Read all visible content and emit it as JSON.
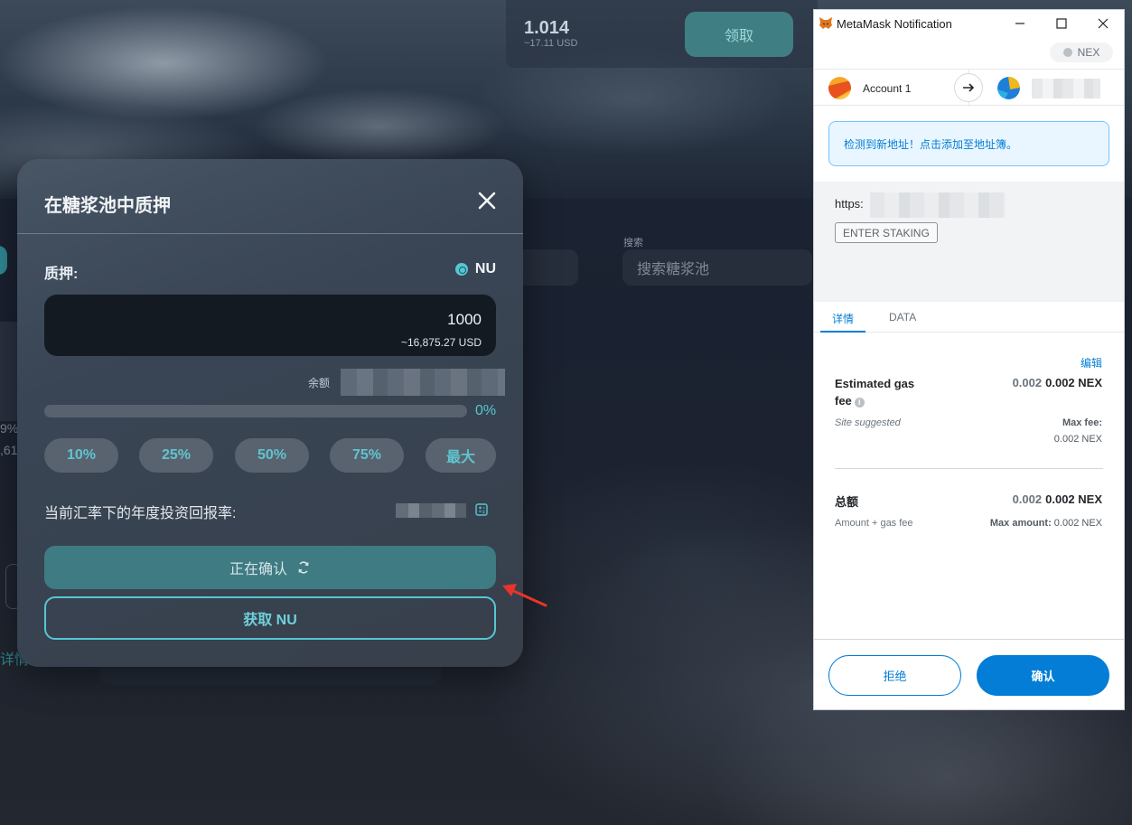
{
  "background": {
    "stat_value": "1.014",
    "stat_usd": "~17.11 USD",
    "claim_label": "领取",
    "search_label": "搜索",
    "search_placeholder": "搜索糖浆池",
    "left_text_1": "9%",
    "left_text_2": ",61",
    "left_text_3": "详情"
  },
  "stake_modal": {
    "title": "在糖浆池中质押",
    "stake_label": "质押:",
    "token": "NU",
    "amount": "1000",
    "amount_usd": "~16,875.27 USD",
    "balance_label": "余额",
    "progress_fraction": 0,
    "progress_pct_label": "0%",
    "percent_buttons": [
      "10%",
      "25%",
      "50%",
      "75%",
      "最大"
    ],
    "apr_label": "当前汇率下的年度投资回报率:",
    "confirming_label": "正在确认",
    "get_token_label": "获取 NU"
  },
  "metamask": {
    "window_title": "MetaMask Notification",
    "network": "NEX",
    "account_name": "Account 1",
    "new_address_notice": "检测到新地址！点击添加至地址簿。",
    "origin": "https:",
    "method": "ENTER STAKING",
    "tabs": [
      "详情",
      "DATA"
    ],
    "edit_label": "编辑",
    "gas_label": "Estimated gas fee",
    "gas_value_secondary": "0.002",
    "gas_value_primary": "0.002 NEX",
    "site_suggested": "Site suggested",
    "max_fee_label": "Max fee:",
    "max_fee_value": "0.002 NEX",
    "total_label": "总额",
    "total_value_secondary": "0.002",
    "total_value_primary": "0.002 NEX",
    "total_sub": "Amount + gas fee",
    "max_amount_label": "Max amount:",
    "max_amount_value": "0.002 NEX",
    "reject_label": "拒绝",
    "confirm_label": "确认"
  },
  "colors": {
    "accent_teal": "#56c6d2",
    "metamask_blue": "#037dd6",
    "arrow_red": "#e8342a"
  }
}
